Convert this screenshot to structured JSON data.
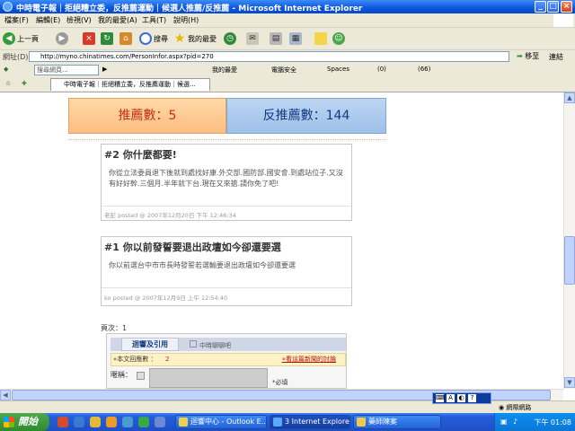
{
  "window": {
    "title": "中時電子報｜拒絕糟立委，反推薦運動｜候選人推薦/反推薦 - Microsoft Internet Explorer",
    "minimize": "_",
    "maximize": "□",
    "close": "×"
  },
  "menu": [
    "檔案(F)",
    "編輯(E)",
    "檢視(V)",
    "我的最愛(A)",
    "工具(T)",
    "說明(H)"
  ],
  "toolbar": {
    "back": "上一頁",
    "search": "搜尋",
    "favorites": "我的最愛"
  },
  "address": {
    "label": "網址(D)",
    "url": "http://myno.chinatimes.com/PersonInfor.aspx?pid=270",
    "go": "移至",
    "links": "連結"
  },
  "searchbar": {
    "placeholder": "搜尋網頁...",
    "items": [
      "我的最愛",
      "電腦安全",
      "Spaces",
      "(0)",
      "(66)"
    ]
  },
  "tab": {
    "title": "中時電子報｜拒絕糟立委，反推薦運動｜候選..."
  },
  "counters": {
    "recommend": "推薦數：5",
    "anti": "反推薦數：144"
  },
  "posts": [
    {
      "title": "#2 你什麼都要!",
      "body": "你從立法委員退下後就到處找好康.外交部.國防部.國安會.到處站位子.又沒有好好幹.三個月.半年就下台.現在又來搶.請你免了吧!",
      "meta": "老彭 posted @ 2007年12月20日 下午 12:46:34"
    },
    {
      "title": "#1 你以前發誓要退出政壇如今卻還要選",
      "body": "你以前選台中市市長時發誓若選輸要退出政壇如今卻還要選",
      "meta": "ko posted @ 2007年12月9日 上午 12:54:40"
    }
  ],
  "pager": "頁次：1",
  "reply": {
    "tab_active": "迴響及引用",
    "tab_other": "中時聊聊吧",
    "count_label": "»本文回應數 ：",
    "count_value": "2",
    "discussion_link": "»看這篇新聞的討論",
    "nickname_label": "暱稱：",
    "required": "*必填"
  },
  "status": {
    "zone": "網際網路"
  },
  "taskbar": {
    "start": "開始",
    "tasks": [
      "迴響中心 - Outlook E...",
      "3 Internet Explorer",
      "藥師陳案"
    ],
    "clock": "下午 01:08"
  }
}
